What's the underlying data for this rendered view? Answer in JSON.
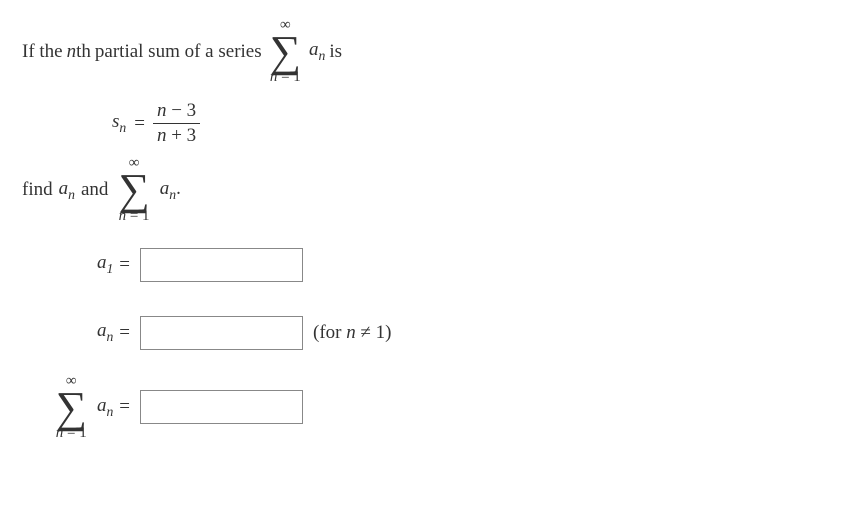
{
  "line1": {
    "pre": "If the ",
    "nth": "n",
    "th": "th",
    "mid": " partial sum of a series ",
    "sigma_upper": "∞",
    "sigma_lower_pre": "n",
    "sigma_lower_mid": " = 1",
    "a": "a",
    "a_sub": "n",
    "post": " is"
  },
  "sn": {
    "s": "s",
    "s_sub": "n",
    "eq": "=",
    "num_n": "n",
    "num_rest": " − 3",
    "den_n": "n",
    "den_rest": " + 3"
  },
  "find": {
    "pre": "find ",
    "a": "a",
    "a_sub": "n",
    "mid": " and ",
    "sigma_upper": "∞",
    "sigma_lower_pre": "n",
    "sigma_lower_mid": " = 1",
    "a2": "a",
    "a2_sub": "n",
    "period": "."
  },
  "ans1": {
    "a": "a",
    "sub": "1",
    "eq": "=",
    "value": ""
  },
  "ans2": {
    "a": "a",
    "sub": "n",
    "eq": "=",
    "value": "",
    "after_pre": "(for ",
    "after_n": "n",
    "after_rest": " ≠ 1)"
  },
  "ans3": {
    "sigma_upper": "∞",
    "sigma_lower_pre": "n",
    "sigma_lower_mid": " = 1",
    "a": "a",
    "sub": "n",
    "eq": "=",
    "value": ""
  }
}
